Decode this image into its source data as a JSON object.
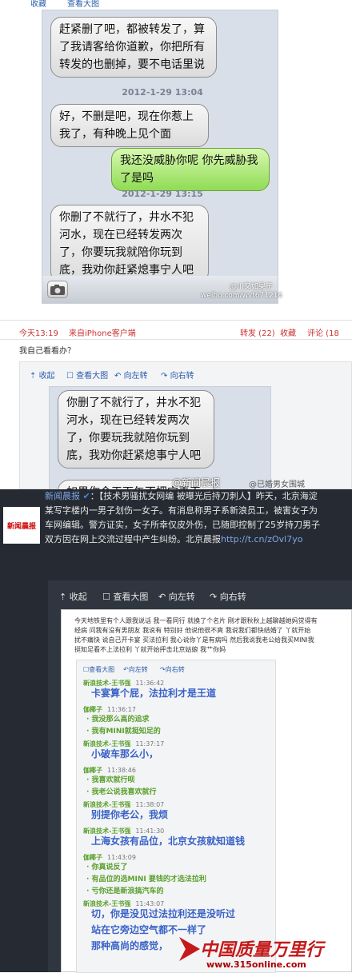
{
  "top_tools": {
    "collect": "收藏",
    "view_big": "查看大图"
  },
  "chat1": {
    "b1": "赶紧删了吧，都被转发了，算了我请客给你道歉，你把所有转发的也删掉，要不电话里说",
    "t1": "2012-1-29 13:04",
    "b2": "好，不删是吧，现在你惹上我了，有种晚上见个面",
    "b3": "我还没威胁你呢 你先威胁我了是吗",
    "t2": "2012-1-29 13:15",
    "b4": "你删了不就行了，井水不犯河水，现在已经转发两次了，你要玩我就陪你玩到底，我劝你赶紧熄事宁人吧",
    "wm1": "@川又如果子",
    "wm2": "weibo.com/wvt671216"
  },
  "meta1": {
    "time": "今天13:19",
    "source": "来自iPhone客户端",
    "repost": "转发 (22)",
    "collect": "收藏",
    "comment": "评论 (18"
  },
  "comment_line": "我自己看看办？",
  "tools": {
    "collect": "收起",
    "view_big": "查看大图",
    "rotate_left": "向左转",
    "rotate_right": "向右转"
  },
  "chat2": {
    "b1": "你删了不就行了，井水不犯河水，现在已经转发两次了，你要玩我就陪你玩到底，我劝你赶紧熄事宁人吧",
    "b2": "如果你今天下午不把它弄干净，事情可就大了",
    "wm1": "@新闻晨报",
    "wm2": "@已婚男女围城"
  },
  "sec2": {
    "logo": "新闻晨报",
    "name": "新闻晨报",
    "l1": "：【技术男骚扰女网编 被曝光后持刀刺人】昨天，北京海淀",
    "l2": "某写字楼内一男子划伤一女子。有消息称男子系新浪员工，被害女子为",
    "l3": "车网编辑。警方证实，女子所幸仅皮外伤，已随即控制了25岁持刀男子",
    "l4": "双方因在网上交流过程中产生纠纷。北京晨报",
    "link": "http://t.cn/zOvl7yo",
    "tools": {
      "collect": "收起",
      "view_big": "查看大图",
      "rotate_left": "向左转",
      "rotate_right": "向右转"
    },
    "doc_lines": [
      "今天地铁里有个人跟我说话 我一看同行 就换了个名片 刚才跟秋秋上越聊越她妈觉得有",
      "经病 问我有没有男朋友 我说有 特别好 他说他很不爽 我说我们都快结婚了 丫就开始",
      "扰不痛快 说自己开卡宴 买法拉利 我心说你丫是有病吗 然后我说我老公给我买MINI我",
      "挺知足看不上法拉利 丫就开始抨击北京姑娘 我艹你妈"
    ],
    "inner_tools": {
      "view_big": "查看大图",
      "rotate_left": "向左转",
      "rotate_right": "向右转"
    },
    "chat": [
      {
        "who": "新浪技术-王书强",
        "time": "11:36:42",
        "kind": "h"
      },
      {
        "text": "卡宴算个屁，法拉利才是王道",
        "kind": "blue"
      },
      {
        "who": "伽椰子",
        "time": "11:36:17",
        "kind": "h"
      },
      {
        "text": "· 我没那么高的追求",
        "kind": "green"
      },
      {
        "text": "· 我有MINI就挺知足的",
        "kind": "green"
      },
      {
        "who": "新浪技术-王书强",
        "time": "11:37:17",
        "kind": "h"
      },
      {
        "text": "小破车那么小，",
        "kind": "blue"
      },
      {
        "who": "伽椰子",
        "time": "11:38:46",
        "kind": "h"
      },
      {
        "text": "· 我喜欢就行呗",
        "kind": "green"
      },
      {
        "text": "· 我老公说我喜欢就行",
        "kind": "green"
      },
      {
        "who": "新浪技术-王书强",
        "time": "11:38:07",
        "kind": "h"
      },
      {
        "text": "别提你老公，我烦",
        "kind": "blue"
      },
      {
        "who": "新浪技术-王书强",
        "time": "11:41:30",
        "kind": "h"
      },
      {
        "text": "上海女孩有品位，北京女孩就知道钱",
        "kind": "blue"
      },
      {
        "who": "伽椰子",
        "time": "11:43:09",
        "kind": "h"
      },
      {
        "text": "· 你真说反了",
        "kind": "green"
      },
      {
        "text": "· 有品位的选MINI 要钱的才选法拉利",
        "kind": "green"
      },
      {
        "text": "· 亏你还是新浪搞汽车的",
        "kind": "green"
      },
      {
        "who": "新浪技术-王书强",
        "time": "11:43:07",
        "kind": "h"
      },
      {
        "text": "切，你是没见过法拉利还是没听过",
        "kind": "blue"
      },
      {
        "text": "站在它旁边空气都不一样了",
        "kind": "blue"
      },
      {
        "text": "那种高尚的感觉，",
        "kind": "blue"
      }
    ],
    "watermark1": "中国质量万里行",
    "watermark2": "www.315online.com",
    "watermark3": "@新闻晨报"
  }
}
